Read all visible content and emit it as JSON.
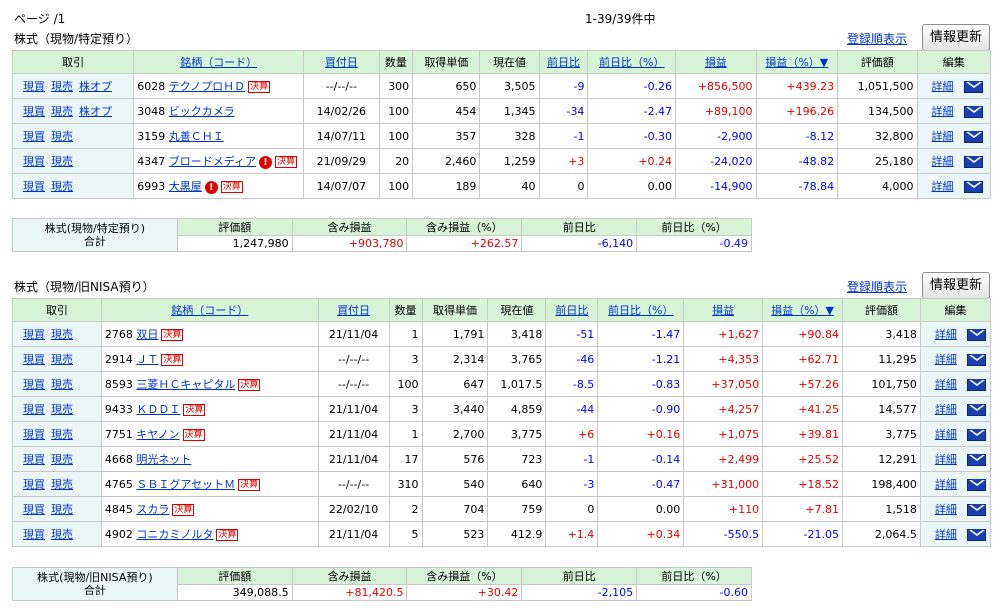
{
  "page_label": "ページ /1",
  "count_label": "1-39/39件中",
  "sections": [
    {
      "title": "株式（現物/特定預り）",
      "registration_link": "登録順表示",
      "refresh_button": "情報更新",
      "headers": [
        "取引",
        "銘柄（コード）",
        "買付日",
        "数量",
        "取得単価",
        "現在値",
        "前日比",
        "前日比（%）",
        "損益",
        "損益（%）▼",
        "評価額",
        "編集"
      ],
      "rows": [
        {
          "actions": [
            "現買",
            "現売",
            "株オプ"
          ],
          "code": "6028",
          "name": "テクノプロＨＤ",
          "kessan": true,
          "alert": false,
          "date": "--/--/--",
          "qty": "300",
          "cost": "650",
          "price": "3,505",
          "chg": "-9",
          "chg_pct": "-0.26",
          "pl": "+856,500",
          "pl_pct": "+439.23",
          "value": "1,051,500"
        },
        {
          "actions": [
            "現買",
            "現売",
            "株オプ"
          ],
          "code": "3048",
          "name": "ビックカメラ",
          "kessan": false,
          "alert": false,
          "date": "14/02/26",
          "qty": "100",
          "cost": "454",
          "price": "1,345",
          "chg": "-34",
          "chg_pct": "-2.47",
          "pl": "+89,100",
          "pl_pct": "+196.26",
          "value": "134,500"
        },
        {
          "actions": [
            "現買",
            "現売"
          ],
          "code": "3159",
          "name": "丸善ＣＨＩ",
          "kessan": false,
          "alert": false,
          "date": "14/07/11",
          "qty": "100",
          "cost": "357",
          "price": "328",
          "chg": "-1",
          "chg_pct": "-0.30",
          "pl": "-2,900",
          "pl_pct": "-8.12",
          "value": "32,800"
        },
        {
          "actions": [
            "現買",
            "現売"
          ],
          "code": "4347",
          "name": "ブロードメディア",
          "kessan": true,
          "alert": true,
          "date": "21/09/29",
          "qty": "20",
          "cost": "2,460",
          "price": "1,259",
          "chg": "+3",
          "chg_pct": "+0.24",
          "pl": "-24,020",
          "pl_pct": "-48.82",
          "value": "25,180"
        },
        {
          "actions": [
            "現買",
            "現売"
          ],
          "code": "6993",
          "name": "大黒屋",
          "kessan": true,
          "alert": true,
          "date": "14/07/07",
          "qty": "100",
          "cost": "189",
          "price": "40",
          "chg": "0",
          "chg_pct": "0.00",
          "pl": "-14,900",
          "pl_pct": "-78.84",
          "value": "4,000"
        }
      ],
      "edit_label": "詳細",
      "summary": {
        "label1": "株式(現物/特定預り)",
        "label2": "合計",
        "headers": [
          "評価額",
          "含み損益",
          "含み損益（%）",
          "前日比",
          "前日比（%）"
        ],
        "values": [
          "1,247,980",
          "+903,780",
          "+262.57",
          "-6,140",
          "-0.49"
        ]
      }
    },
    {
      "title": "株式（現物/旧NISA預り）",
      "registration_link": "登録順表示",
      "refresh_button": "情報更新",
      "headers": [
        "取引",
        "銘柄（コード）",
        "買付日",
        "数量",
        "取得単価",
        "現在値",
        "前日比",
        "前日比（%）",
        "損益",
        "損益（%）▼",
        "評価額",
        "編集"
      ],
      "rows": [
        {
          "actions": [
            "現買",
            "現売"
          ],
          "code": "2768",
          "name": "双日",
          "kessan": true,
          "alert": false,
          "date": "21/11/04",
          "qty": "1",
          "cost": "1,791",
          "price": "3,418",
          "chg": "-51",
          "chg_pct": "-1.47",
          "pl": "+1,627",
          "pl_pct": "+90.84",
          "value": "3,418"
        },
        {
          "actions": [
            "現買",
            "現売"
          ],
          "code": "2914",
          "name": "ＪＴ",
          "kessan": true,
          "alert": false,
          "date": "--/--/--",
          "qty": "3",
          "cost": "2,314",
          "price": "3,765",
          "chg": "-46",
          "chg_pct": "-1.21",
          "pl": "+4,353",
          "pl_pct": "+62.71",
          "value": "11,295"
        },
        {
          "actions": [
            "現買",
            "現売"
          ],
          "code": "8593",
          "name": "三菱ＨＣキャピタル",
          "kessan": true,
          "alert": false,
          "date": "--/--/--",
          "qty": "100",
          "cost": "647",
          "price": "1,017.5",
          "chg": "-8.5",
          "chg_pct": "-0.83",
          "pl": "+37,050",
          "pl_pct": "+57.26",
          "value": "101,750"
        },
        {
          "actions": [
            "現買",
            "現売"
          ],
          "code": "9433",
          "name": "ＫＤＤＩ",
          "kessan": true,
          "alert": false,
          "date": "21/11/04",
          "qty": "3",
          "cost": "3,440",
          "price": "4,859",
          "chg": "-44",
          "chg_pct": "-0.90",
          "pl": "+4,257",
          "pl_pct": "+41.25",
          "value": "14,577"
        },
        {
          "actions": [
            "現買",
            "現売"
          ],
          "code": "7751",
          "name": "キヤノン",
          "kessan": true,
          "alert": false,
          "date": "21/11/04",
          "qty": "1",
          "cost": "2,700",
          "price": "3,775",
          "chg": "+6",
          "chg_pct": "+0.16",
          "pl": "+1,075",
          "pl_pct": "+39.81",
          "value": "3,775"
        },
        {
          "actions": [
            "現買",
            "現売"
          ],
          "code": "4668",
          "name": "明光ネット",
          "kessan": false,
          "alert": false,
          "date": "21/11/04",
          "qty": "17",
          "cost": "576",
          "price": "723",
          "chg": "-1",
          "chg_pct": "-0.14",
          "pl": "+2,499",
          "pl_pct": "+25.52",
          "value": "12,291"
        },
        {
          "actions": [
            "現買",
            "現売"
          ],
          "code": "4765",
          "name": "ＳＢＩグアセットＭ",
          "kessan": true,
          "alert": false,
          "date": "--/--/--",
          "qty": "310",
          "cost": "540",
          "price": "640",
          "chg": "-3",
          "chg_pct": "-0.47",
          "pl": "+31,000",
          "pl_pct": "+18.52",
          "value": "198,400"
        },
        {
          "actions": [
            "現買",
            "現売"
          ],
          "code": "4845",
          "name": "スカラ",
          "kessan": true,
          "alert": false,
          "date": "22/02/10",
          "qty": "2",
          "cost": "704",
          "price": "759",
          "chg": "0",
          "chg_pct": "0.00",
          "pl": "+110",
          "pl_pct": "+7.81",
          "value": "1,518"
        },
        {
          "actions": [
            "現買",
            "現売"
          ],
          "code": "4902",
          "name": "コニカミノルタ",
          "kessan": true,
          "alert": false,
          "date": "21/11/04",
          "qty": "5",
          "cost": "523",
          "price": "412.9",
          "chg": "+1.4",
          "chg_pct": "+0.34",
          "pl": "-550.5",
          "pl_pct": "-21.05",
          "value": "2,064.5"
        }
      ],
      "edit_label": "詳細",
      "summary": {
        "label1": "株式(現物/旧NISA預り)",
        "label2": "合計",
        "headers": [
          "評価額",
          "含み損益",
          "含み損益（%）",
          "前日比",
          "前日比（%）"
        ],
        "values": [
          "349,088.5",
          "+81,420.5",
          "+30.42",
          "-2,105",
          "-0.60"
        ]
      }
    }
  ],
  "kessan_label": "決算",
  "alert_glyph": "!",
  "colors": {
    "header_bg": "#d7f4d6",
    "cell_bg": "#ebf6f7",
    "positive": "#e60000",
    "negative": "#0000ff",
    "link": "#0033cc"
  }
}
